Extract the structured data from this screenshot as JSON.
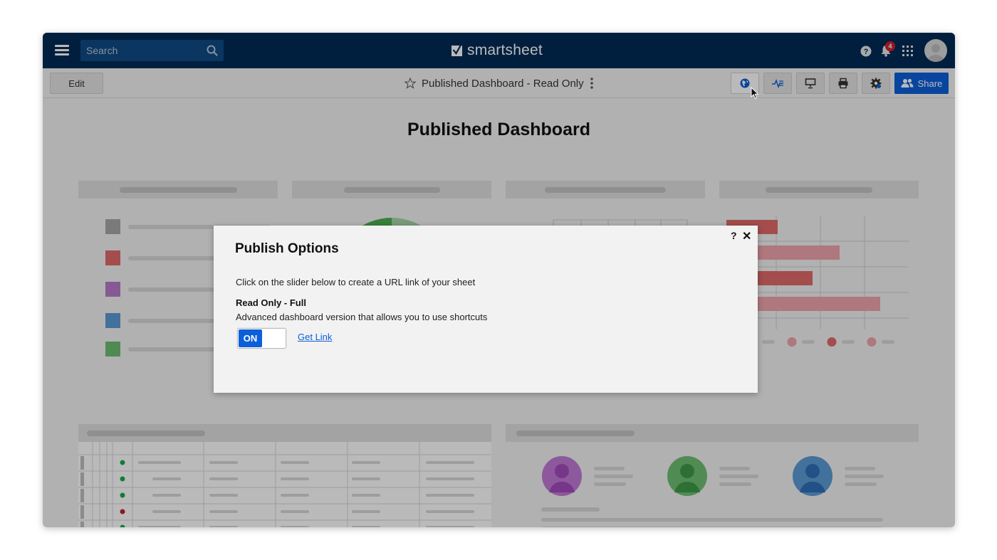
{
  "topbar": {
    "search_placeholder": "Search",
    "brand": "smartsheet",
    "notification_count": "4"
  },
  "toolbar": {
    "edit_label": "Edit",
    "dashboard_title": "Published Dashboard - Read Only",
    "share_label": "Share"
  },
  "dashboard": {
    "heading": "Published Dashboard",
    "legend_colors": [
      "#a8a8a8",
      "#e06a6a",
      "#b97ac9",
      "#5b9bd5",
      "#6dbd72"
    ],
    "people_colors": [
      "#a24bbd",
      "#3f9a48",
      "#2e6fb8"
    ],
    "table_status_colors": [
      "#1ea84a",
      "#1ea84a",
      "#1ea84a",
      "#c0202e",
      "#1ea84a",
      "#e7b416"
    ],
    "bar_chart_colors": [
      "#e06a6a",
      "#f0a3ad",
      "#e06a6a",
      "#f0a3ad"
    ]
  },
  "modal": {
    "title": "Publish Options",
    "help_label": "?",
    "close_label": "✕",
    "instruction": "Click on the slider below to create a URL link of your sheet",
    "option_label": "Read Only - Full",
    "option_description": "Advanced dashboard version that allows you to use shortcuts",
    "toggle_state": "ON",
    "get_link_label": "Get Link"
  }
}
